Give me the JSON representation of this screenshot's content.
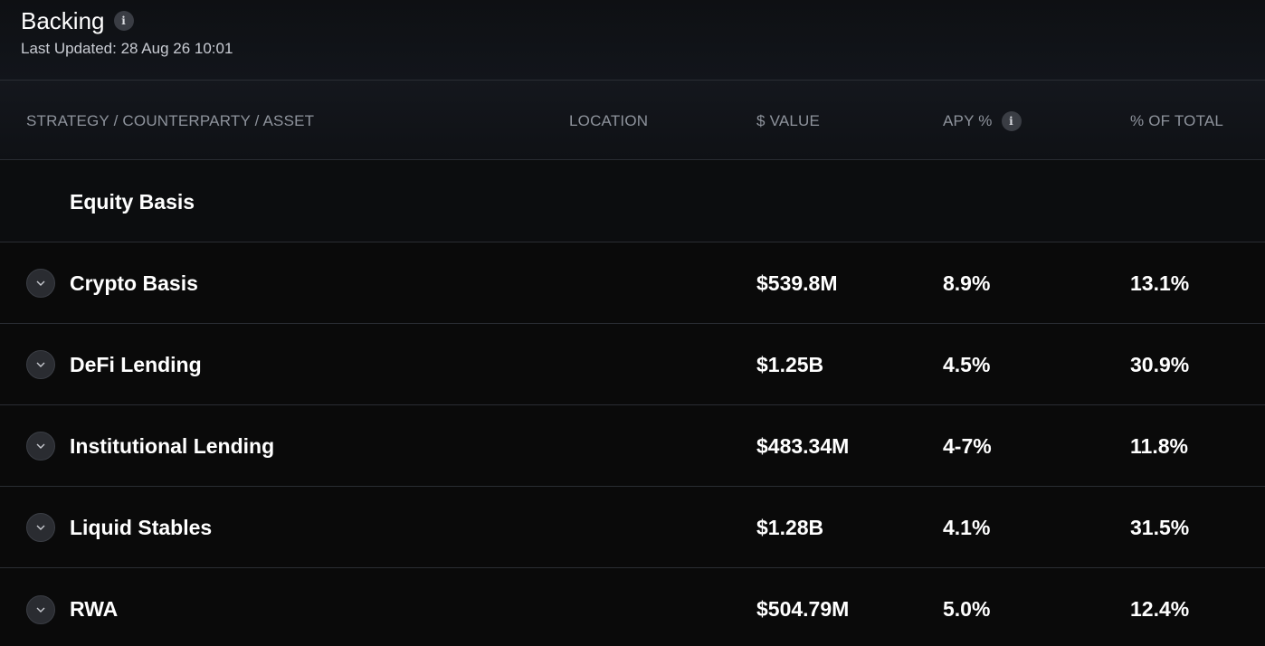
{
  "header": {
    "title": "Backing",
    "title_info_icon": "info-icon",
    "last_updated": "Last Updated: 28 Aug 26 10:01"
  },
  "table": {
    "columns": [
      "STRATEGY / COUNTERPARTY / ASSET",
      "LOCATION",
      "$ VALUE",
      "APY %",
      "% OF TOTAL"
    ],
    "apy_info_icon": "info-icon",
    "group_label": "Equity Basis",
    "rows": [
      {
        "name": "Crypto Basis",
        "value": "$539.8M",
        "apy": "8.9%",
        "pct": "13.1%"
      },
      {
        "name": "DeFi Lending",
        "value": "$1.25B",
        "apy": "4.5%",
        "pct": "30.9%"
      },
      {
        "name": "Institutional Lending",
        "value": "$483.34M",
        "apy": "4-7%",
        "pct": "11.8%"
      },
      {
        "name": "Liquid Stables",
        "value": "$1.28B",
        "apy": "4.1%",
        "pct": "31.5%"
      },
      {
        "name": "RWA",
        "value": "$504.79M",
        "apy": "5.0%",
        "pct": "12.4%"
      }
    ]
  },
  "colors": {
    "background": "#0a0a0a",
    "header_text": "#ffffff",
    "muted_text": "#8e939c",
    "divider": "#2a2d33"
  }
}
